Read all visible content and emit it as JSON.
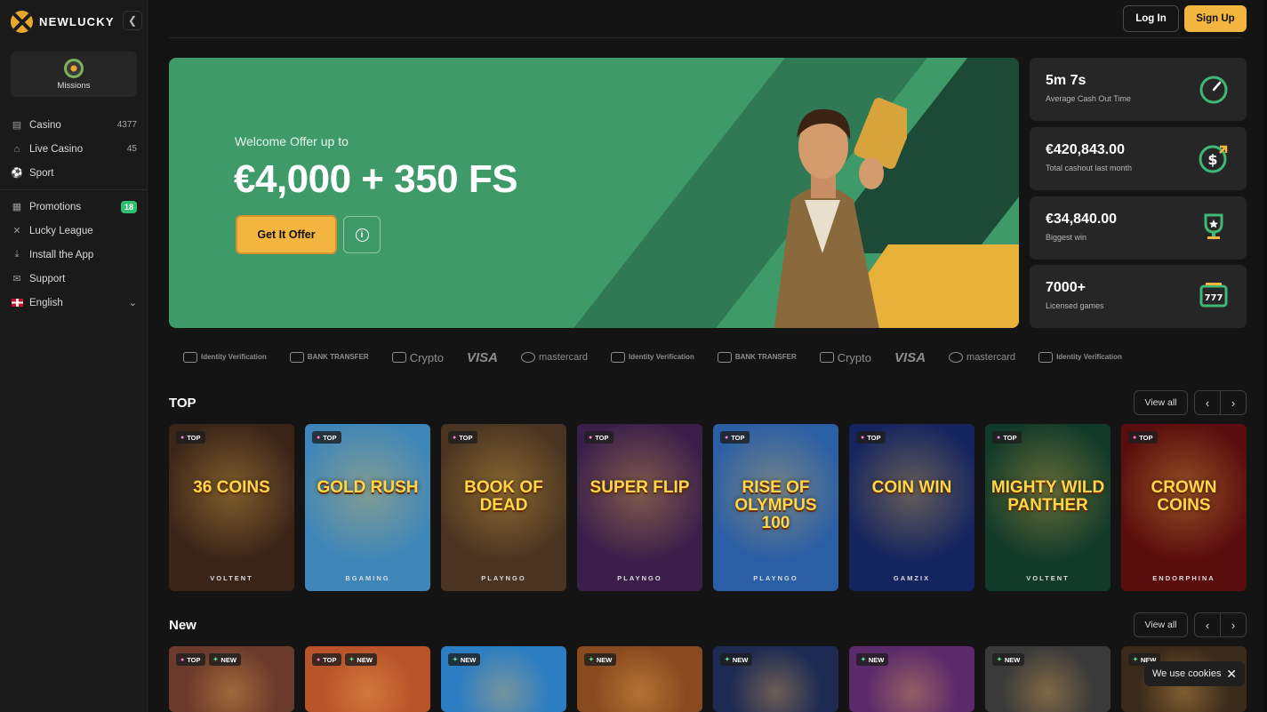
{
  "brand": {
    "name": "NEWLUCKY"
  },
  "sidebar": {
    "missions_label": "Missions",
    "items": [
      {
        "label": "Casino",
        "count": "4377",
        "icon": "casino-icon"
      },
      {
        "label": "Live Casino",
        "count": "45",
        "icon": "live-casino-icon"
      },
      {
        "label": "Sport",
        "count": "",
        "icon": "sport-icon"
      }
    ],
    "items2": [
      {
        "label": "Promotions",
        "badge": "18",
        "icon": "gift-icon"
      },
      {
        "label": "Lucky League",
        "icon": "league-icon"
      },
      {
        "label": "Install the App",
        "icon": "download-icon"
      },
      {
        "label": "Support",
        "icon": "chat-icon"
      },
      {
        "label": "English",
        "icon": "uk-flag-icon"
      }
    ]
  },
  "header": {
    "login": "Log In",
    "signup": "Sign Up"
  },
  "hero": {
    "subtitle": "Welcome Offer up to",
    "title": "€4,000 + 350 FS",
    "cta": "Get It Offer"
  },
  "stats": [
    {
      "value": "5m 7s",
      "label": "Average Cash Out Time",
      "icon": "stopwatch-icon"
    },
    {
      "value": "€420,843.00",
      "label": "Total cashout last month",
      "icon": "dollar-cashout-icon"
    },
    {
      "value": "€34,840.00",
      "label": "Biggest win",
      "icon": "trophy-icon"
    },
    {
      "value": "7000+",
      "label": "Licensed games",
      "icon": "slot-777-icon"
    }
  ],
  "payments": {
    "identity": "Identity Verification",
    "bank": "BANK TRANSFER",
    "crypto": "Crypto",
    "visa": "VISA",
    "mastercard": "mastercard"
  },
  "top": {
    "title": "TOP",
    "view_all": "View all",
    "tag": "TOP",
    "games": [
      {
        "name": "36 COINS",
        "provider": "VOLTENT",
        "bg": "#3a2418"
      },
      {
        "name": "GOLD RUSH",
        "provider": "BGAMING",
        "bg": "#3f86b8"
      },
      {
        "name": "BOOK OF DEAD",
        "provider": "PLAYNGO",
        "bg": "#4a3421"
      },
      {
        "name": "SUPER FLIP",
        "provider": "PLAYNGO",
        "bg": "#3b1f4a"
      },
      {
        "name": "RISE OF OLYMPUS 100",
        "provider": "PLAYNGO",
        "bg": "#2a5ea5"
      },
      {
        "name": "COIN WIN",
        "provider": "GAMZIX",
        "bg": "#14245e"
      },
      {
        "name": "MIGHTY WILD PANTHER",
        "provider": "VOLTENT",
        "bg": "#123a2a"
      },
      {
        "name": "CROWN COINS",
        "provider": "ENDORPHINA",
        "bg": "#5a0d0d"
      }
    ]
  },
  "new": {
    "title": "New",
    "view_all": "View all",
    "tag_top": "TOP",
    "tag_new": "NEW",
    "games": [
      {
        "bg": "#6b3a2a",
        "top": true
      },
      {
        "bg": "#b8532a",
        "top": true
      },
      {
        "bg": "#2c7dc2",
        "top": false
      },
      {
        "bg": "#8a4a1f",
        "top": false
      },
      {
        "bg": "#1d2a52",
        "top": false
      },
      {
        "bg": "#5a2a6a",
        "top": false
      },
      {
        "bg": "#3a3a3a",
        "top": false
      },
      {
        "bg": "#3a2a1a",
        "top": false
      }
    ]
  },
  "cookie": {
    "text": "We use cookies"
  },
  "colors": {
    "accent": "#f2b640",
    "hero_green": "#3f9a6a",
    "badge_green": "#2fbf71"
  }
}
